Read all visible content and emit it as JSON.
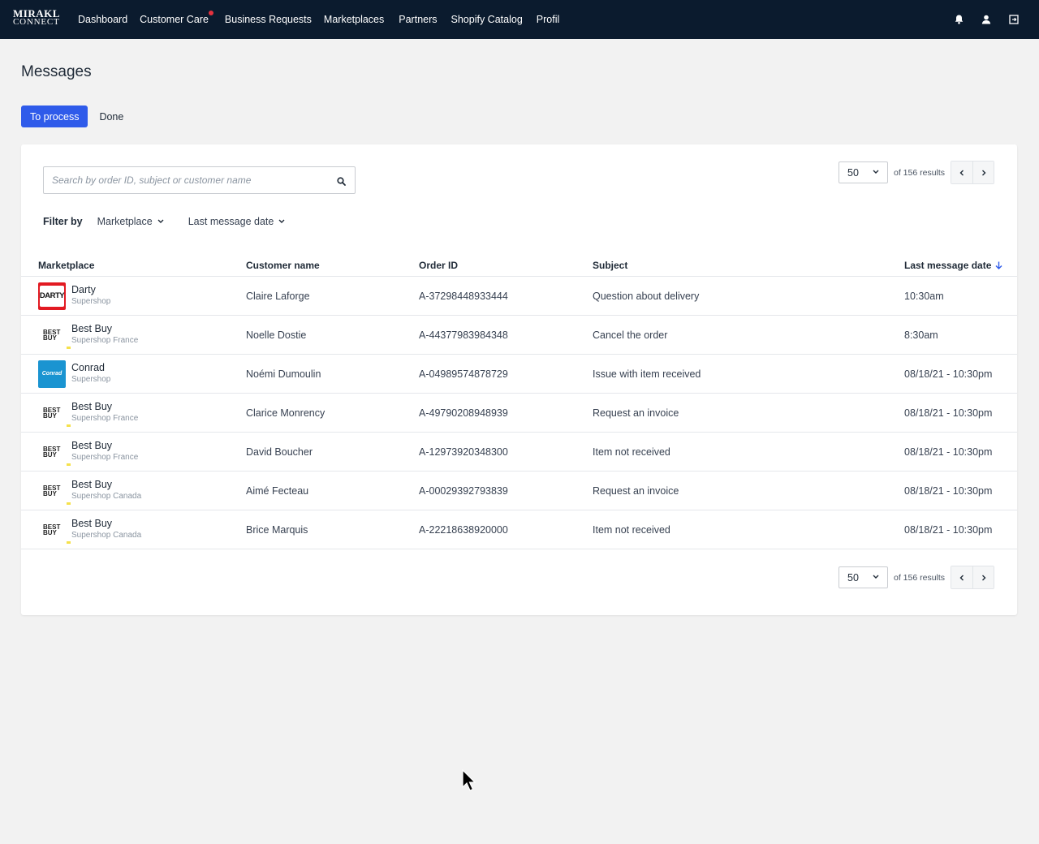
{
  "logo": {
    "line1": "MIRAKL",
    "line2": "CONNECT"
  },
  "nav": {
    "items": [
      {
        "label": "Dashboard",
        "dot": false
      },
      {
        "label": "Customer Care",
        "dot": true
      },
      {
        "label": "Business Requests",
        "dot": false
      },
      {
        "label": "Marketplaces",
        "dot": false
      },
      {
        "label": "Partners",
        "dot": false
      },
      {
        "label": "Shopify Catalog",
        "dot": false
      },
      {
        "label": "Profil",
        "dot": false
      }
    ],
    "icons": [
      "bell-icon",
      "user-icon",
      "logout-icon"
    ]
  },
  "page": {
    "title": "Messages"
  },
  "tabs": [
    {
      "label": "To process",
      "active": true
    },
    {
      "label": "Done",
      "active": false
    }
  ],
  "search": {
    "placeholder": "Search by order ID, subject or customer name",
    "icon": "search-icon"
  },
  "pagination": {
    "per_page": "50",
    "results_text": "of 156 results"
  },
  "filters": {
    "label": "Filter by",
    "items": [
      {
        "label": "Marketplace"
      },
      {
        "label": "Last message date"
      }
    ]
  },
  "table": {
    "headers": {
      "marketplace": "Marketplace",
      "customer": "Customer name",
      "order": "Order ID",
      "subject": "Subject",
      "date": "Last message date"
    },
    "rows": [
      {
        "logo": "darty",
        "logo_text": "DARTY",
        "marketplace": "Darty",
        "shop": "Supershop",
        "customer": "Claire Laforge",
        "order": "A-37298448933444",
        "subject": "Question about delivery",
        "date": "10:30am"
      },
      {
        "logo": "bestbuy",
        "logo_text": "BEST BUY",
        "marketplace": "Best Buy",
        "shop": "Supershop France",
        "customer": "Noelle Dostie",
        "order": "A-44377983984348",
        "subject": "Cancel the order",
        "date": "8:30am"
      },
      {
        "logo": "conrad",
        "logo_text": "Conrad",
        "marketplace": "Conrad",
        "shop": "Supershop",
        "customer": "Noémi Dumoulin",
        "order": "A-04989574878729",
        "subject": "Issue with item received",
        "date": "08/18/21 - 10:30pm"
      },
      {
        "logo": "bestbuy",
        "logo_text": "BEST BUY",
        "marketplace": "Best Buy",
        "shop": "Supershop France",
        "customer": "Clarice Monrency",
        "order": "A-49790208948939",
        "subject": "Request an invoice",
        "date": "08/18/21 - 10:30pm"
      },
      {
        "logo": "bestbuy",
        "logo_text": "BEST BUY",
        "marketplace": "Best Buy",
        "shop": "Supershop France",
        "customer": "David Boucher",
        "order": "A-12973920348300",
        "subject": "Item not received",
        "date": "08/18/21 - 10:30pm"
      },
      {
        "logo": "bestbuy",
        "logo_text": "BEST BUY",
        "marketplace": "Best Buy",
        "shop": "Supershop Canada",
        "customer": "Aimé Fecteau",
        "order": "A-00029392793839",
        "subject": "Request an invoice",
        "date": "08/18/21 - 10:30pm"
      },
      {
        "logo": "bestbuy",
        "logo_text": "BEST BUY",
        "marketplace": "Best Buy",
        "shop": "Supershop Canada",
        "customer": "Brice Marquis",
        "order": "A-22218638920000",
        "subject": "Item not received",
        "date": "08/18/21 - 10:30pm"
      }
    ]
  },
  "colors": {
    "nav_bg": "#0b1b2e",
    "accent": "#2f5bea",
    "notification_dot": "#e5323e",
    "darty_red": "#e21a22",
    "conrad_blue": "#1a94d1"
  }
}
